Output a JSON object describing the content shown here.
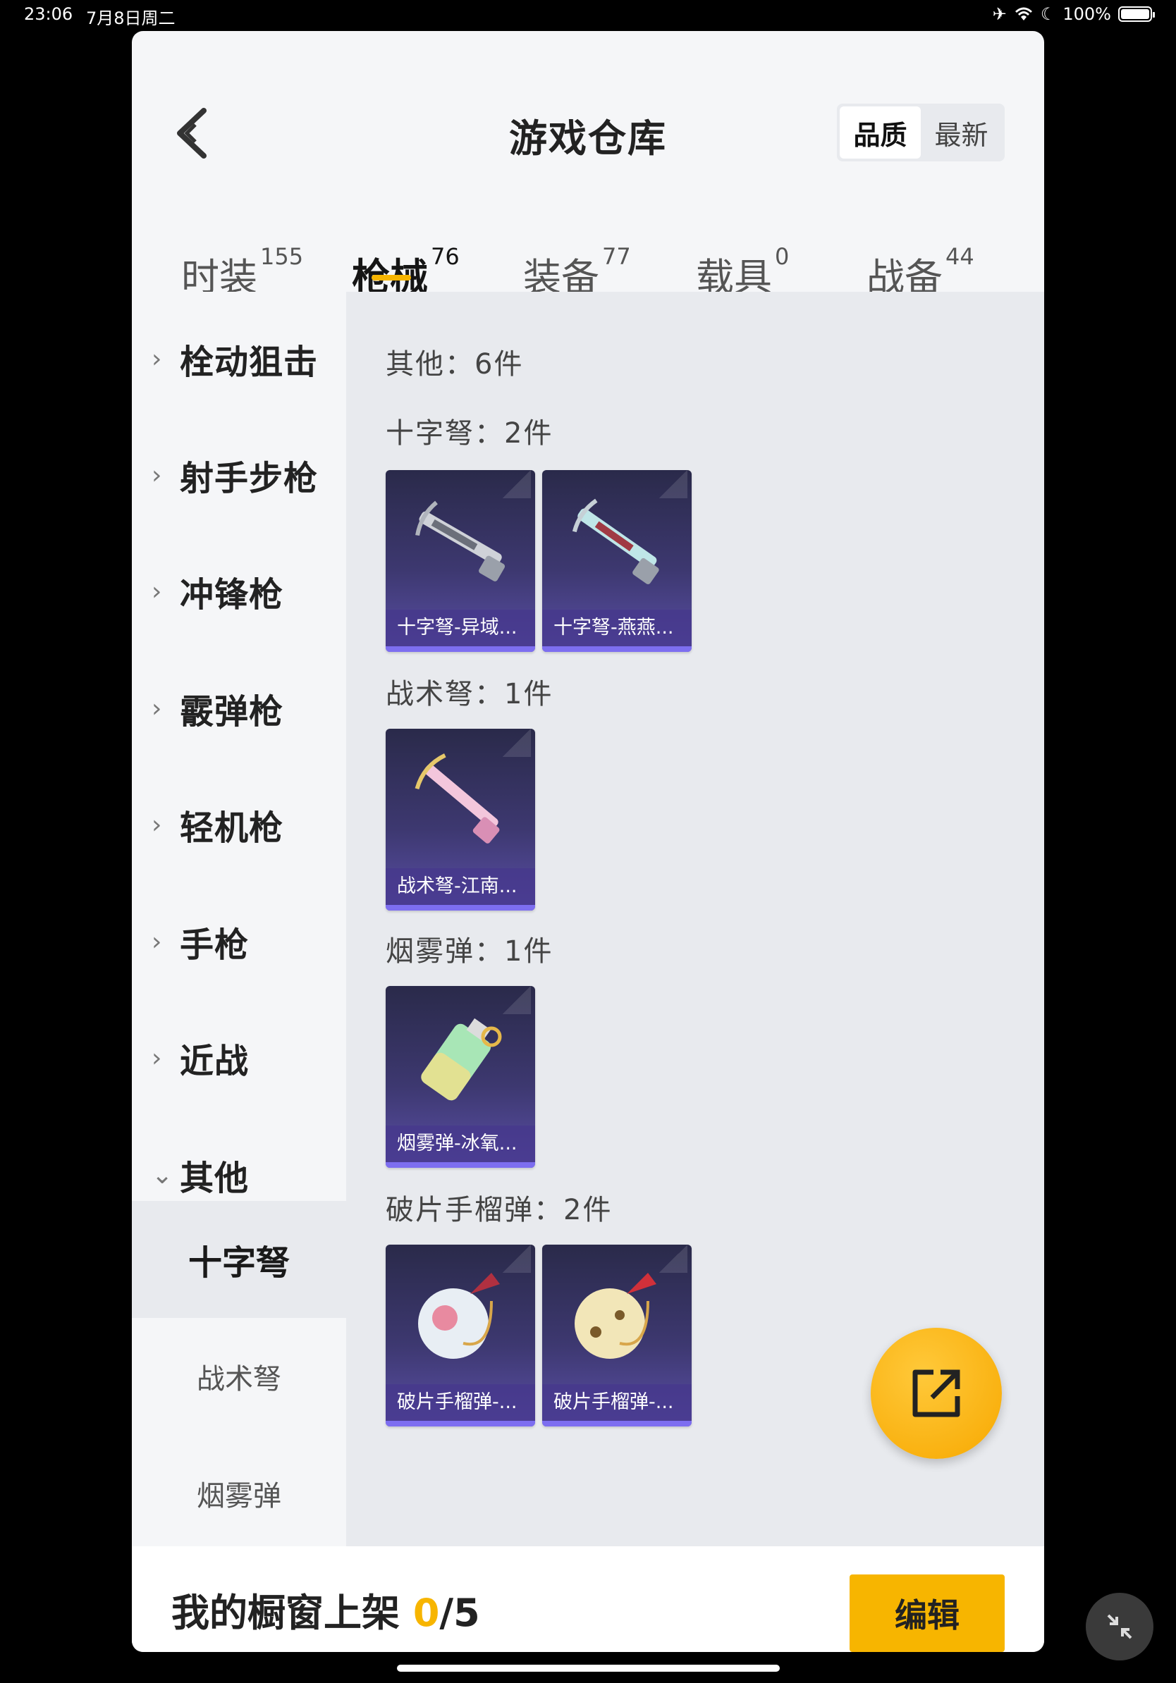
{
  "status_bar": {
    "time": "23:06",
    "date": "7月8日周二",
    "battery": "100%"
  },
  "header": {
    "title": "游戏仓库",
    "sort_options": [
      "品质",
      "最新"
    ],
    "sort_active": "品质"
  },
  "tabs": [
    {
      "label": "时装",
      "count": "155"
    },
    {
      "label": "枪械",
      "count": "76",
      "active": true
    },
    {
      "label": "装备",
      "count": "77"
    },
    {
      "label": "载具",
      "count": "0"
    },
    {
      "label": "战备",
      "count": "44"
    }
  ],
  "sidebar": {
    "categories": [
      "栓动狙击",
      "射手步枪",
      "冲锋枪",
      "霰弹枪",
      "轻机枪",
      "手枪",
      "近战",
      "其他"
    ],
    "expanded": "其他",
    "subcategories": [
      "十字弩",
      "战术弩",
      "烟雾弹"
    ],
    "active_sub": "十字弩"
  },
  "main": {
    "summary": "其他：6件",
    "sections": [
      {
        "title": "十字弩：2件",
        "items": [
          "十字弩-异域...",
          "十字弩-燕燕..."
        ]
      },
      {
        "title": "战术弩：1件",
        "items": [
          "战术弩-江南..."
        ]
      },
      {
        "title": "烟雾弹：1件",
        "items": [
          "烟雾弹-冰氧..."
        ]
      },
      {
        "title": "破片手榴弹：2件",
        "items": [
          "破片手榴弹-...",
          "破片手榴弹-..."
        ]
      }
    ]
  },
  "bottom_bar": {
    "label": "我的橱窗上架",
    "current": "0",
    "total": "/5",
    "edit_label": "编辑"
  },
  "colors": {
    "accent": "#f7b500",
    "card_bottom": "#5a4fa6"
  },
  "icons": [
    "back-icon",
    "share-icon",
    "collapse-icon",
    "chevron-right-icon",
    "chevron-down-icon"
  ]
}
